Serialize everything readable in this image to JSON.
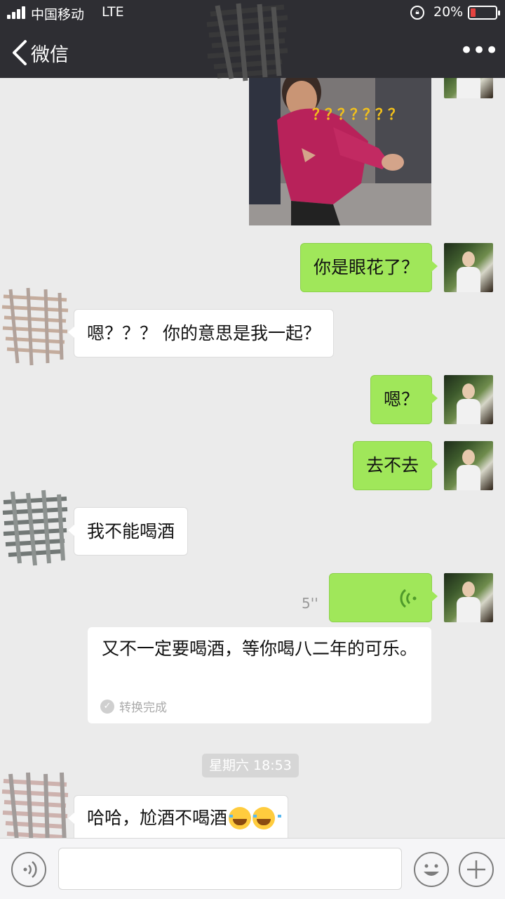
{
  "status_bar": {
    "carrier": "中国移动",
    "network": "LTE",
    "battery_percent": "20%",
    "battery_level": 0.2
  },
  "nav": {
    "back_label": "微信",
    "more_label": "•••"
  },
  "sticker": {
    "overlay_text": "？？？？？？？"
  },
  "messages": [
    {
      "sender": "me",
      "text": "你是眼花了？"
    },
    {
      "sender": "other",
      "text": "嗯？？？ 你的意思是我一起？"
    },
    {
      "sender": "me",
      "text": "嗯？"
    },
    {
      "sender": "me",
      "text": "去不去"
    },
    {
      "sender": "other",
      "text": "我不能喝酒"
    },
    {
      "sender": "me",
      "type": "voice",
      "duration": "5''"
    },
    {
      "sender": "other",
      "text": "哈哈，尬酒不喝酒"
    }
  ],
  "transcript": {
    "text": "又不一定要喝酒，等你喝八二年的可乐。",
    "status": "转换完成"
  },
  "timestamp": "星期六 18:53",
  "colors": {
    "my_bubble": "#a0e75a",
    "other_bubble": "#ffffff",
    "nav_bg": "#2e2e33",
    "chat_bg": "#ebebeb"
  }
}
